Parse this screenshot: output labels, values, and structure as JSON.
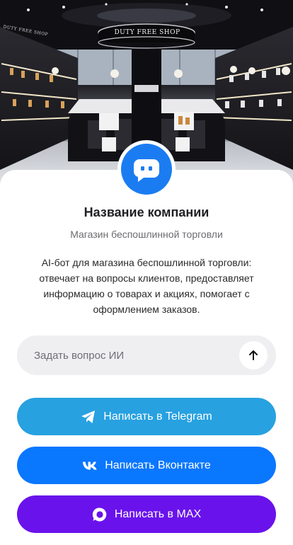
{
  "hero": {
    "sign": "DUTY FREE SHOP",
    "side_sign": "DUTY FREE SHOP"
  },
  "company": {
    "name": "Название компании",
    "subtitle": "Магазин беспошлинной торговли",
    "description": "AI-бот для магазина беспошлинной торговли: отвечает на вопросы клиентов, предоставляет информацию о товарах и акциях, помогает с оформлением заказов.",
    "avatar_icon": "chat-bot-icon",
    "accent_color": "#1b7cf2"
  },
  "ask": {
    "placeholder": "Задать вопрос ИИ",
    "send_icon": "arrow-up-icon"
  },
  "buttons": {
    "telegram": {
      "label": "Написать в Telegram",
      "icon": "telegram-icon",
      "color": "#27a1e0"
    },
    "vk": {
      "label": "Написать Вконтакте",
      "icon": "vk-icon",
      "color": "#0a77ff"
    },
    "max": {
      "label": "Написать в MAX",
      "icon": "max-icon",
      "color": "#6a12ec"
    }
  }
}
